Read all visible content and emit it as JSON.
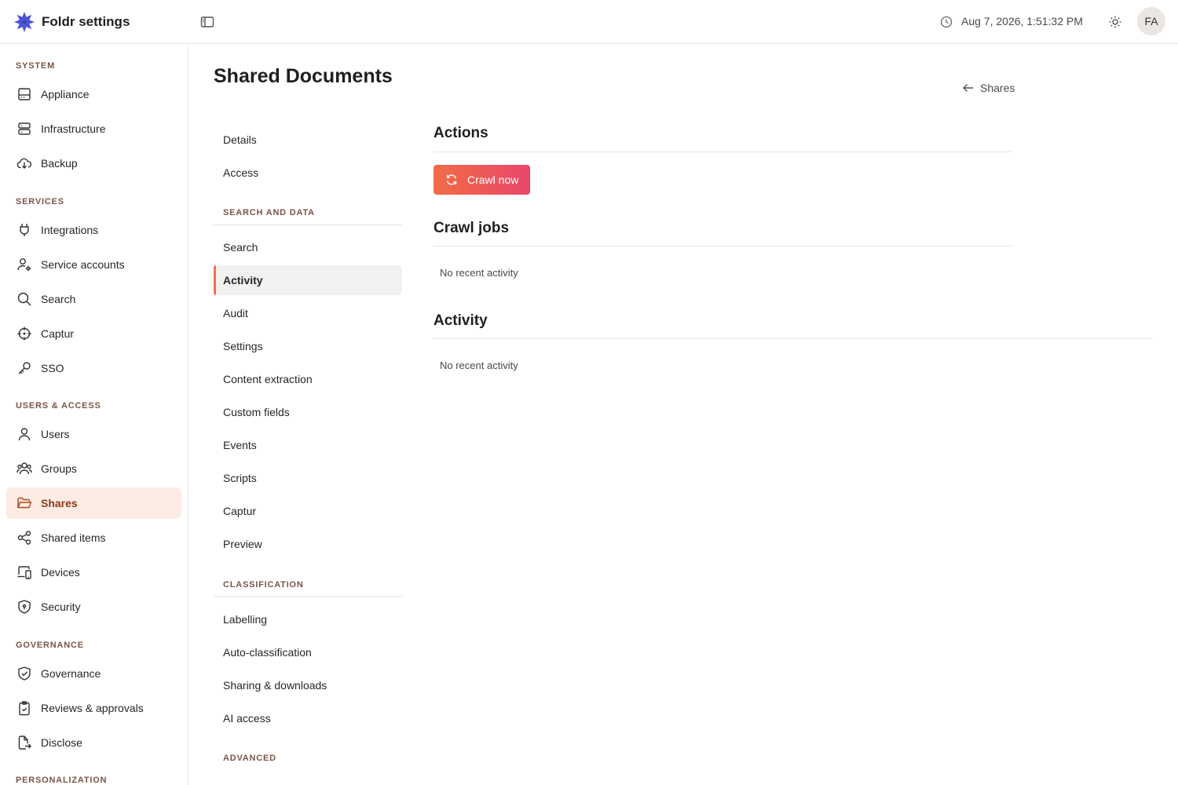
{
  "header": {
    "app_title": "Foldr settings",
    "datetime": "Aug 7, 2026, 1:51:32 PM",
    "avatar_initials": "FA",
    "brand_color": "#4a52d8"
  },
  "sidebar": {
    "sections": {
      "system": "SYSTEM",
      "services": "SERVICES",
      "users_access": "USERS & ACCESS",
      "governance": "GOVERNANCE",
      "personalization": "PERSONALIZATION"
    },
    "items": {
      "appliance": "Appliance",
      "infrastructure": "Infrastructure",
      "backup": "Backup",
      "integrations": "Integrations",
      "service_accounts": "Service accounts",
      "search": "Search",
      "captur": "Captur",
      "sso": "SSO",
      "users": "Users",
      "groups": "Groups",
      "shares": "Shares",
      "shared_items": "Shared items",
      "devices": "Devices",
      "security": "Security",
      "governance": "Governance",
      "reviews": "Reviews & approvals",
      "disclose": "Disclose"
    },
    "active_item": "Shares",
    "active_color": "#fdece3"
  },
  "page": {
    "title": "Shared Documents",
    "back_label": "Shares"
  },
  "subnav": {
    "items_top": [
      "Details",
      "Access"
    ],
    "section_search": "SEARCH AND DATA",
    "items_search": [
      "Search",
      "Activity",
      "Audit",
      "Settings",
      "Content extraction",
      "Custom fields",
      "Events",
      "Scripts",
      "Captur",
      "Preview"
    ],
    "section_classification": "CLASSIFICATION",
    "items_classification": [
      "Labelling",
      "Auto-classification",
      "Sharing & downloads",
      "AI access"
    ],
    "section_advanced": "ADVANCED",
    "active_item": "Activity",
    "accent_color": "#f07050"
  },
  "content": {
    "actions_title": "Actions",
    "crawl_button": "Crawl now",
    "crawl_jobs_title": "Crawl jobs",
    "crawl_jobs_empty": "No recent activity",
    "activity_title": "Activity",
    "activity_empty": "No recent activity",
    "button_gradient": [
      "#f26c45",
      "#e8466c"
    ]
  }
}
